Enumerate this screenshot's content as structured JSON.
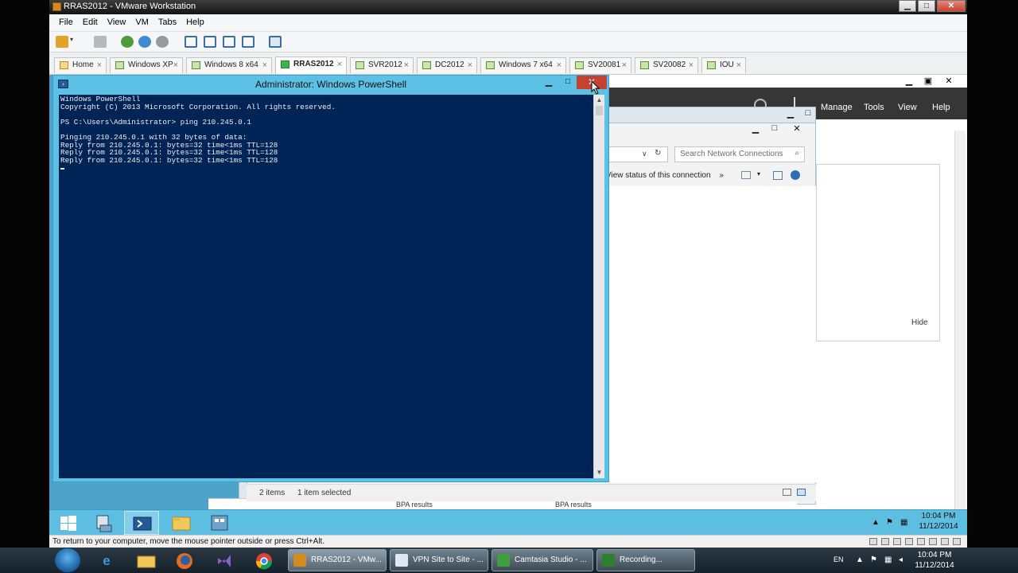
{
  "vmware": {
    "title": "RRAS2012 - VMware Workstation",
    "menu": [
      "File",
      "Edit",
      "View",
      "VM",
      "Tabs",
      "Help"
    ],
    "tabs": [
      "Home",
      "Windows XP",
      "Windows 8 x64",
      "RRAS2012",
      "SVR2012",
      "DC2012",
      "Windows 7 x64",
      "SV20081",
      "SV20082",
      "IOU"
    ],
    "active_tab": "RRAS2012",
    "status_text": "To return to your computer, move the mouse pointer outside or press Ctrl+Alt."
  },
  "powershell": {
    "title": "Administrator: Windows PowerShell",
    "lines": [
      "Windows PowerShell",
      "Copyright (C) 2013 Microsoft Corporation. All rights reserved.",
      "",
      "PS C:\\Users\\Administrator> ping 210.245.0.1",
      "",
      "Pinging 210.245.0.1 with 32 bytes of data:",
      "Reply from 210.245.0.1: bytes=32 time<1ms TTL=128",
      "Reply from 210.245.0.1: bytes=32 time<1ms TTL=128",
      "Reply from 210.245.0.1: bytes=32 time<1ms TTL=128"
    ]
  },
  "server_manager": {
    "menu": [
      "Manage",
      "Tools",
      "View",
      "Help"
    ],
    "hide_label": "Hide"
  },
  "network_connections": {
    "search_placeholder": "Search Network Connections",
    "command": "View status of this connection",
    "overflow": "»",
    "status_items": "2 items",
    "status_selected": "1 item selected",
    "behind_labels": [
      "BPA results",
      "BPA results"
    ]
  },
  "guest_taskbar": {
    "time": "10:04 PM",
    "date": "11/12/2014"
  },
  "host_taskbar": {
    "buttons": [
      "RRAS2012 - VMw...",
      "VPN Site to Site - ...",
      "Camtasia Studio - ...",
      "Recording..."
    ],
    "language": "EN",
    "time": "10:04 PM",
    "date": "11/12/2014"
  },
  "colors": {
    "console_bg": "#012456",
    "console_fg": "#eeedf0",
    "guest_accent": "#5cc1e4",
    "close_red": "#c74130"
  }
}
